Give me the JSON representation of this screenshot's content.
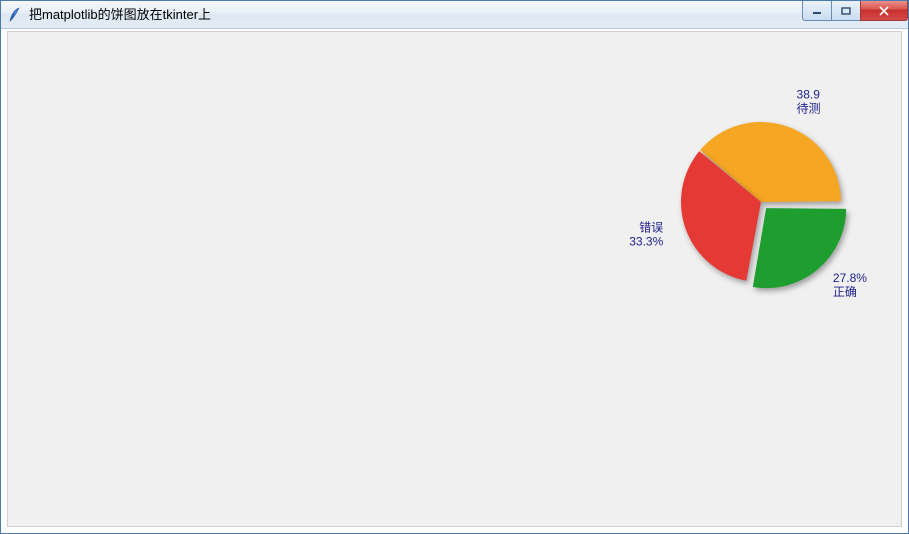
{
  "window": {
    "title": "把matplotlib的饼图放在tkinter上",
    "icon_name": "tk-feather-icon"
  },
  "controls": {
    "minimize": "minimize",
    "maximize": "maximize",
    "close": "close"
  },
  "chart_data": {
    "type": "pie",
    "title": "",
    "slices": [
      {
        "label": "待测",
        "pct_text": "38.9",
        "value": 38.9,
        "color": "#f5a623",
        "exploded": false
      },
      {
        "label": "错误",
        "pct_text": "33.3%",
        "value": 33.3,
        "color": "#e53935",
        "exploded": false
      },
      {
        "label": "正确",
        "pct_text": "27.8%",
        "value": 27.8,
        "color": "#1e9e2f",
        "exploded": true
      }
    ],
    "label_color": "#1b1f8a",
    "start_angle_deg": 0,
    "direction": "counterclockwise"
  }
}
